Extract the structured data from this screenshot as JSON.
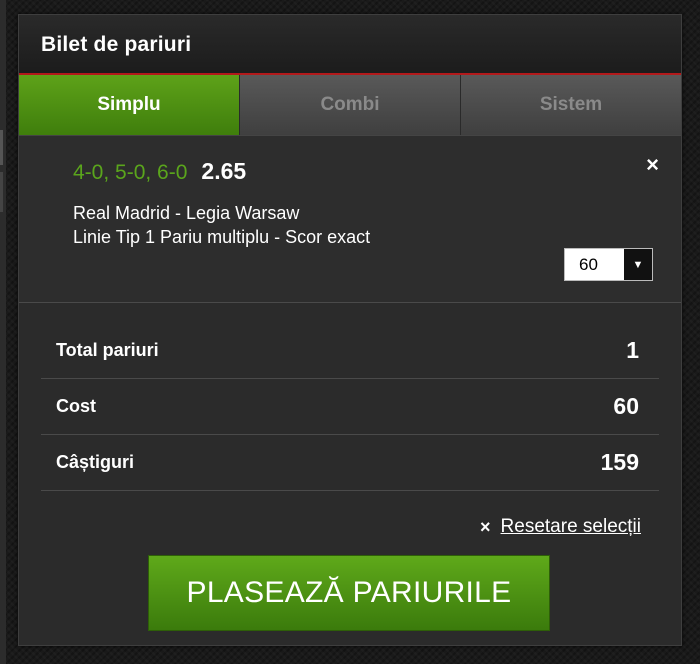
{
  "header": {
    "title": "Bilet de pariuri"
  },
  "tabs": [
    {
      "label": "Simplu",
      "active": true
    },
    {
      "label": "Combi",
      "active": false
    },
    {
      "label": "Sistem",
      "active": false
    }
  ],
  "selection": {
    "scores": "4-0, 5-0, 6-0",
    "odds": "2.65",
    "match": "Real Madrid - Legia Warsaw",
    "market": "Linie Tip 1 Pariu multiplu - Scor exact",
    "remove_icon": "×",
    "stake_value": "60"
  },
  "summary": [
    {
      "label": "Total pariuri",
      "value": "1"
    },
    {
      "label": "Cost",
      "value": "60"
    },
    {
      "label": "Câștiguri",
      "value": "159"
    }
  ],
  "reset": {
    "icon": "×",
    "label": "Resetare selecții"
  },
  "place_button": {
    "label": "PLASEAZĂ PARIURILE"
  },
  "colors": {
    "accent_green": "#5aa51c",
    "header_line": "#b3191b",
    "background": "#2b2b2b"
  }
}
